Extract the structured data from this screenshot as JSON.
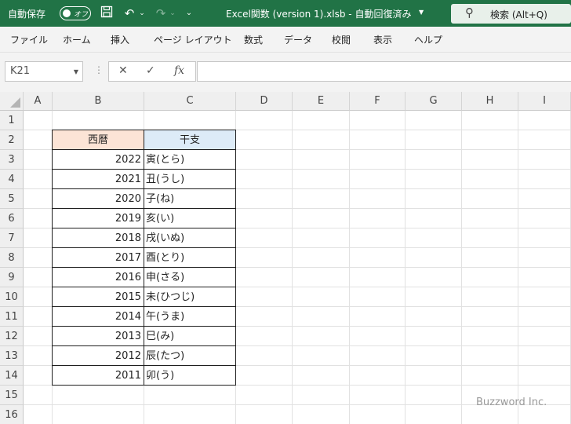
{
  "titlebar": {
    "autosave_label": "自動保存",
    "autosave_state": "オフ",
    "document_title": "Excel関数 (version 1).xlsb  -  自動回復済み",
    "search_label": "検索 (Alt+Q)"
  },
  "ribbon_tabs": [
    "ファイル",
    "ホーム",
    "挿入",
    "ページ レイアウト",
    "数式",
    "データ",
    "校閲",
    "表示",
    "ヘルプ"
  ],
  "formula_bar": {
    "name_box": "K21",
    "cancel_symbol": "✕",
    "enter_symbol": "✓",
    "fx_symbol": "fx",
    "formula": ""
  },
  "columns": [
    "A",
    "B",
    "C",
    "D",
    "E",
    "F",
    "G",
    "H",
    "I"
  ],
  "rows": [
    "1",
    "2",
    "3",
    "4",
    "5",
    "6",
    "7",
    "8",
    "9",
    "10",
    "11",
    "12",
    "13",
    "14",
    "15",
    "16"
  ],
  "table": {
    "header_b": "西暦",
    "header_c": "干支",
    "header_b_color": "#fce4d6",
    "header_c_color": "#ddebf7",
    "rows": [
      {
        "year": "2022",
        "eto": "寅(とら)"
      },
      {
        "year": "2021",
        "eto": "丑(うし)"
      },
      {
        "year": "2020",
        "eto": "子(ね)"
      },
      {
        "year": "2019",
        "eto": "亥(い)"
      },
      {
        "year": "2018",
        "eto": "戌(いぬ)"
      },
      {
        "year": "2017",
        "eto": "酉(とり)"
      },
      {
        "year": "2016",
        "eto": "申(さる)"
      },
      {
        "year": "2015",
        "eto": "未(ひつじ)"
      },
      {
        "year": "2014",
        "eto": "午(うま)"
      },
      {
        "year": "2013",
        "eto": "巳(み)"
      },
      {
        "year": "2012",
        "eto": "辰(たつ)"
      },
      {
        "year": "2011",
        "eto": "卯(う)"
      }
    ]
  },
  "watermark": "Buzzword Inc.",
  "colors": {
    "excel_green": "#217346"
  }
}
